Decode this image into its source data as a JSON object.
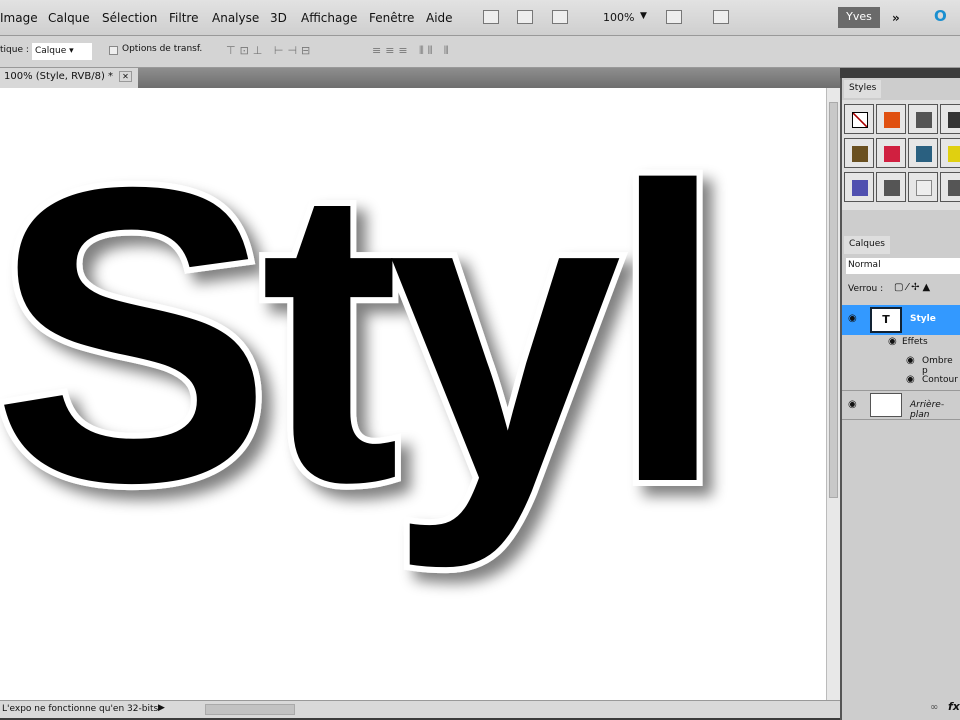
{
  "menu": [
    "Image",
    "Calque",
    "Sélection",
    "Filtre",
    "Analyse",
    "3D",
    "Affichage",
    "Fenêtre",
    "Aide"
  ],
  "toolbar": {
    "zoom": "100%",
    "user": "Yves"
  },
  "options": {
    "label": "tique :",
    "select_value": "Calque",
    "checkbox_label": "Options de transf."
  },
  "document": {
    "tab_title": "100% (Style, RVB/8) *",
    "text": "Styl"
  },
  "status": {
    "message": "L'expo ne fonctionne qu'en 32-bits"
  },
  "styles_panel": {
    "title": "Styles",
    "swatches": [
      "#ffffff",
      "#e05010",
      "#555555",
      "#333333",
      "#6a5020",
      "#d02040",
      "#2a6080",
      "#e0d010",
      "#5050b0",
      "#555555",
      "#eeeeee",
      "#555555"
    ]
  },
  "layers_panel": {
    "title": "Calques",
    "blend_mode": "Normal",
    "lock_label": "Verrou :",
    "layers": [
      {
        "name": "Style",
        "thumb": "T",
        "selected": true
      },
      {
        "name": "Arrière-plan",
        "selected": false
      }
    ],
    "effects_label": "Effets",
    "effects": [
      "Ombre p",
      "Contour"
    ]
  },
  "colors": {
    "selection": "#3399ff"
  }
}
